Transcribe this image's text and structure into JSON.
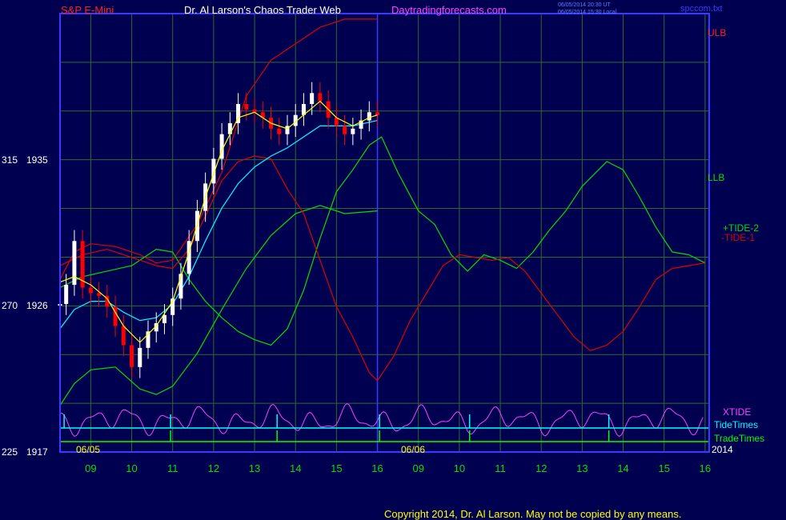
{
  "header": {
    "instrument": "S&P E-Mini",
    "title": "Dr. Al Larson's Chaos Trader Web",
    "site": "Daytradingforecasts.com",
    "timestamp_ut": "06/05/2014 20:30 UT",
    "timestamp_local": "06/05/2014 15:30 Local",
    "filename": "spccom.txt"
  },
  "footer": {
    "copyright": "Copyright 2014, Dr. Al Larson. May not be copied by any means."
  },
  "colors": {
    "background": "#000050",
    "frame": "#3a3aff",
    "grid": "#2f6b2f",
    "price_up": "#ffffff",
    "price_down": "#ff0000",
    "ma_fast": "#ffff00",
    "ma_slow": "#00ffff",
    "tide_plus": "#00e000",
    "tide_minus": "#e00000",
    "xtide": "#ff40ff",
    "tide_times": "#00ffff",
    "trade_times": "#00ff00",
    "label_red": "#ff2020",
    "label_yellow": "#ffff00",
    "label_white": "#ffffff"
  },
  "chart_data": {
    "type": "line",
    "title": "S&P E-Mini",
    "y_axis_labels": [
      {
        "left": "315",
        "price": "1935"
      },
      {
        "left": "270",
        "price": "1926"
      },
      {
        "left": "225",
        "price": "1917"
      }
    ],
    "ylim": [
      1917,
      1949
    ],
    "x_ticks": [
      "09",
      "10",
      "11",
      "12",
      "13",
      "14",
      "15",
      "16",
      "09",
      "10",
      "11",
      "12",
      "13",
      "14",
      "15",
      "16"
    ],
    "x_hours": [
      9,
      10,
      11,
      12,
      13,
      14,
      15,
      16,
      17,
      18,
      19,
      20,
      21,
      22,
      23,
      24
    ],
    "xlim": [
      8.25,
      24.1
    ],
    "day_labels": [
      "06/05",
      "06/06"
    ],
    "day_label_hours": [
      8.45,
      18.45
    ],
    "year_label": "2014",
    "day_separator_hours": [
      8.25,
      16.0
    ],
    "band_labels": {
      "ulb": "ULB",
      "llb": "LLB"
    },
    "legend": [
      {
        "label": "+TIDE-2",
        "color": "#00e000"
      },
      {
        "label": "-TIDE-1",
        "color": "#e00000"
      },
      {
        "label": "XTIDE",
        "color": "#ff40ff"
      },
      {
        "label": "TideTimes",
        "color": "#00ffff"
      },
      {
        "label": "TradeTimes",
        "color": "#00ff00"
      }
    ],
    "price_close": [
      [
        8.25,
        1927.8
      ],
      [
        8.4,
        1929.2
      ],
      [
        8.6,
        1932.4
      ],
      [
        8.8,
        1929.0
      ],
      [
        9.0,
        1928.6
      ],
      [
        9.2,
        1928.4
      ],
      [
        9.4,
        1927.6
      ],
      [
        9.6,
        1926.2
      ],
      [
        9.8,
        1924.8
      ],
      [
        10.0,
        1923.2
      ],
      [
        10.2,
        1924.6
      ],
      [
        10.4,
        1925.8
      ],
      [
        10.6,
        1926.4
      ],
      [
        10.8,
        1927.0
      ],
      [
        11.0,
        1928.2
      ],
      [
        11.2,
        1930.0
      ],
      [
        11.4,
        1932.4
      ],
      [
        11.6,
        1934.6
      ],
      [
        11.8,
        1936.6
      ],
      [
        12.0,
        1938.4
      ],
      [
        12.2,
        1940.2
      ],
      [
        12.4,
        1941.0
      ],
      [
        12.6,
        1942.4
      ],
      [
        12.8,
        1942.0
      ],
      [
        13.0,
        1941.8
      ],
      [
        13.2,
        1941.4
      ],
      [
        13.4,
        1940.6
      ],
      [
        13.6,
        1940.2
      ],
      [
        13.8,
        1940.8
      ],
      [
        14.0,
        1941.6
      ],
      [
        14.2,
        1942.4
      ],
      [
        14.4,
        1943.2
      ],
      [
        14.6,
        1942.6
      ],
      [
        14.8,
        1941.4
      ],
      [
        15.0,
        1940.8
      ],
      [
        15.2,
        1940.2
      ],
      [
        15.4,
        1940.6
      ],
      [
        15.6,
        1941.2
      ],
      [
        15.8,
        1941.8
      ],
      [
        16.0,
        1941.6
      ]
    ],
    "ma_fast": [
      [
        8.25,
        1929.4
      ],
      [
        8.6,
        1929.8
      ],
      [
        9.0,
        1929.2
      ],
      [
        9.4,
        1928.2
      ],
      [
        9.8,
        1926.2
      ],
      [
        10.2,
        1925.0
      ],
      [
        10.6,
        1926.2
      ],
      [
        11.0,
        1928.0
      ],
      [
        11.4,
        1931.6
      ],
      [
        11.8,
        1935.6
      ],
      [
        12.2,
        1939.0
      ],
      [
        12.6,
        1941.4
      ],
      [
        13.0,
        1941.8
      ],
      [
        13.4,
        1941.0
      ],
      [
        13.8,
        1940.6
      ],
      [
        14.2,
        1941.6
      ],
      [
        14.6,
        1942.6
      ],
      [
        15.0,
        1941.4
      ],
      [
        15.4,
        1940.8
      ],
      [
        15.8,
        1941.4
      ],
      [
        16.0,
        1941.6
      ]
    ],
    "ma_slow": [
      [
        8.25,
        1926.0
      ],
      [
        8.6,
        1927.4
      ],
      [
        9.0,
        1928.0
      ],
      [
        9.4,
        1928.0
      ],
      [
        9.8,
        1927.2
      ],
      [
        10.2,
        1926.6
      ],
      [
        10.6,
        1926.8
      ],
      [
        11.0,
        1927.8
      ],
      [
        11.4,
        1929.8
      ],
      [
        11.8,
        1932.4
      ],
      [
        12.2,
        1934.8
      ],
      [
        12.6,
        1936.6
      ],
      [
        13.0,
        1937.8
      ],
      [
        13.4,
        1938.6
      ],
      [
        13.8,
        1939.2
      ],
      [
        14.2,
        1940.0
      ],
      [
        14.6,
        1940.8
      ],
      [
        15.0,
        1940.8
      ],
      [
        15.4,
        1940.8
      ],
      [
        16.0,
        1941.2
      ]
    ],
    "ulb": [
      [
        8.25,
        1929.6
      ],
      [
        8.6,
        1931.6
      ],
      [
        9.0,
        1932.2
      ],
      [
        9.6,
        1932.0
      ],
      [
        10.2,
        1931.4
      ],
      [
        10.6,
        1930.8
      ],
      [
        11.0,
        1931.0
      ],
      [
        11.6,
        1933.6
      ],
      [
        12.2,
        1937.4
      ],
      [
        12.8,
        1943.0
      ],
      [
        13.4,
        1945.6
      ],
      [
        14.0,
        1946.8
      ],
      [
        14.6,
        1948.0
      ],
      [
        15.2,
        1948.6
      ],
      [
        16.0,
        1948.6
      ]
    ],
    "llb": [
      [
        8.25,
        1920.4
      ],
      [
        8.6,
        1922.0
      ],
      [
        9.0,
        1923.0
      ],
      [
        9.6,
        1923.2
      ],
      [
        10.2,
        1921.6
      ],
      [
        10.6,
        1921.2
      ],
      [
        11.0,
        1921.8
      ],
      [
        11.6,
        1924.2
      ],
      [
        12.2,
        1927.4
      ],
      [
        12.8,
        1930.4
      ],
      [
        13.4,
        1932.8
      ],
      [
        14.0,
        1934.4
      ],
      [
        14.6,
        1935.0
      ],
      [
        15.2,
        1934.4
      ],
      [
        16.0,
        1934.6
      ]
    ],
    "tide_plus": [
      [
        8.25,
        1929.0
      ],
      [
        8.8,
        1929.8
      ],
      [
        9.4,
        1930.2
      ],
      [
        10.0,
        1930.6
      ],
      [
        10.6,
        1931.8
      ],
      [
        11.0,
        1931.6
      ],
      [
        11.4,
        1929.6
      ],
      [
        11.8,
        1928.0
      ],
      [
        12.2,
        1926.8
      ],
      [
        12.6,
        1925.8
      ],
      [
        13.0,
        1925.2
      ],
      [
        13.4,
        1924.8
      ],
      [
        13.8,
        1926.0
      ],
      [
        14.2,
        1928.8
      ],
      [
        14.6,
        1932.6
      ],
      [
        15.0,
        1936.0
      ],
      [
        15.4,
        1937.6
      ],
      [
        15.8,
        1939.4
      ],
      [
        16.1,
        1940.0
      ],
      [
        16.5,
        1937.4
      ],
      [
        17.0,
        1934.6
      ],
      [
        17.4,
        1933.6
      ],
      [
        17.8,
        1931.4
      ],
      [
        18.2,
        1930.2
      ],
      [
        18.6,
        1931.4
      ],
      [
        19.0,
        1931.0
      ],
      [
        19.4,
        1930.4
      ],
      [
        19.8,
        1931.6
      ],
      [
        20.2,
        1933.2
      ],
      [
        20.6,
        1934.6
      ],
      [
        21.0,
        1936.4
      ],
      [
        21.6,
        1938.2
      ],
      [
        22.0,
        1937.6
      ],
      [
        22.4,
        1935.6
      ],
      [
        22.8,
        1933.4
      ],
      [
        23.2,
        1931.6
      ],
      [
        23.6,
        1931.4
      ],
      [
        24.0,
        1930.8
      ]
    ],
    "tide_minus": [
      [
        8.25,
        1930.6
      ],
      [
        8.8,
        1931.4
      ],
      [
        9.4,
        1931.8
      ],
      [
        10.0,
        1931.2
      ],
      [
        10.6,
        1930.6
      ],
      [
        11.0,
        1930.4
      ],
      [
        11.4,
        1931.8
      ],
      [
        11.8,
        1934.2
      ],
      [
        12.2,
        1936.8
      ],
      [
        12.6,
        1938.2
      ],
      [
        13.0,
        1938.6
      ],
      [
        13.4,
        1938.4
      ],
      [
        13.8,
        1936.2
      ],
      [
        14.2,
        1934.4
      ],
      [
        14.6,
        1931.0
      ],
      [
        15.0,
        1927.6
      ],
      [
        15.4,
        1925.4
      ],
      [
        15.8,
        1922.8
      ],
      [
        16.0,
        1922.2
      ],
      [
        16.4,
        1924.0
      ],
      [
        16.8,
        1926.6
      ],
      [
        17.2,
        1928.6
      ],
      [
        17.6,
        1930.6
      ],
      [
        18.0,
        1931.4
      ],
      [
        18.4,
        1931.2
      ],
      [
        18.8,
        1931.0
      ],
      [
        19.2,
        1931.2
      ],
      [
        19.6,
        1930.2
      ],
      [
        20.0,
        1928.6
      ],
      [
        20.4,
        1927.0
      ],
      [
        20.8,
        1925.4
      ],
      [
        21.2,
        1924.4
      ],
      [
        21.6,
        1924.8
      ],
      [
        22.0,
        1925.8
      ],
      [
        22.4,
        1927.6
      ],
      [
        22.8,
        1929.6
      ],
      [
        23.2,
        1930.4
      ],
      [
        23.6,
        1930.6
      ],
      [
        24.0,
        1930.8
      ]
    ],
    "tide_times": [
      8.35,
      10.95,
      13.55,
      16.05,
      18.25,
      21.65
    ],
    "trade_times": [
      10.95,
      13.55,
      16.05,
      18.25,
      21.65
    ]
  }
}
